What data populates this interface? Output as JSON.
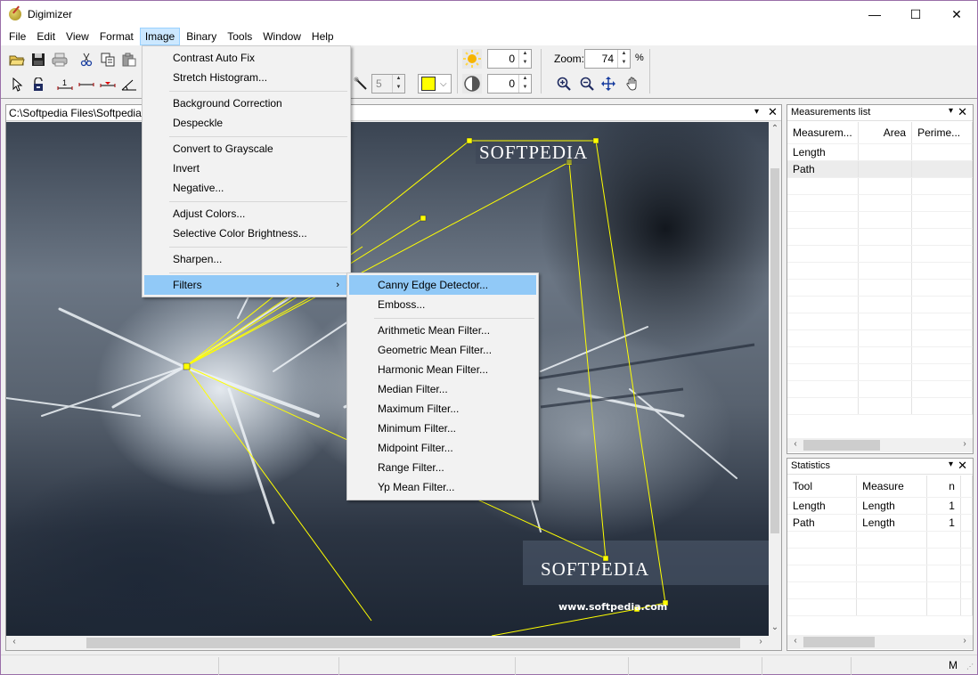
{
  "app": {
    "title": "Digimizer",
    "window_controls": {
      "minimize": "—",
      "maximize": "☐",
      "close": "✕"
    }
  },
  "menubar": {
    "items": [
      {
        "label": "File"
      },
      {
        "label": "Edit"
      },
      {
        "label": "View"
      },
      {
        "label": "Format"
      },
      {
        "label": "Image",
        "active": true
      },
      {
        "label": "Binary"
      },
      {
        "label": "Tools"
      },
      {
        "label": "Window"
      },
      {
        "label": "Help"
      }
    ]
  },
  "toolbar": {
    "row1_icons": [
      "open-folder-icon",
      "save-icon",
      "print-icon",
      "cut-icon",
      "copy-icon",
      "paste-icon"
    ],
    "row2_icons": [
      "pointer-icon",
      "unlock-icon",
      "length-marker-icon",
      "line-icon",
      "path-marker-icon",
      "angle-icon"
    ],
    "magic_wand_tolerance": "5",
    "color_swatch": "#ffff00",
    "brightness_value": "0",
    "contrast_value": "0",
    "zoom_label": "Zoom:",
    "zoom_value": "74",
    "zoom_unit": "%"
  },
  "document": {
    "path": "C:\\Softpedia Files\\Softpedia W",
    "watermark_top": "SOFTPEDIA",
    "watermark_bottom": "SOFTPEDIA",
    "watermark_url": "www.softpedia.com",
    "overlay_color": "#ffff00"
  },
  "image_menu": {
    "items": [
      {
        "label": "Contrast Auto Fix"
      },
      {
        "label": "Stretch Histogram..."
      },
      {
        "separator": true
      },
      {
        "label": "Background Correction"
      },
      {
        "label": "Despeckle"
      },
      {
        "separator": true
      },
      {
        "label": "Convert to Grayscale"
      },
      {
        "label": "Invert"
      },
      {
        "label": "Negative..."
      },
      {
        "separator": true
      },
      {
        "label": "Adjust Colors..."
      },
      {
        "label": "Selective Color Brightness..."
      },
      {
        "separator": true
      },
      {
        "label": "Sharpen..."
      },
      {
        "separator": true
      },
      {
        "label": "Filters",
        "submenu": true,
        "highlighted": true
      }
    ]
  },
  "filters_submenu": {
    "items": [
      {
        "label": "Canny Edge Detector...",
        "highlighted": true
      },
      {
        "label": "Emboss..."
      },
      {
        "separator": true
      },
      {
        "label": "Arithmetic Mean Filter..."
      },
      {
        "label": "Geometric Mean Filter..."
      },
      {
        "label": "Harmonic Mean Filter..."
      },
      {
        "label": "Median Filter..."
      },
      {
        "label": "Maximum Filter..."
      },
      {
        "label": "Minimum Filter..."
      },
      {
        "label": "Midpoint Filter..."
      },
      {
        "label": "Range Filter..."
      },
      {
        "label": "Yp Mean Filter..."
      }
    ]
  },
  "measurements_list": {
    "title": "Measurements list",
    "columns": [
      "Measurem...",
      "Area",
      "Perime..."
    ],
    "rows": [
      [
        "Length",
        "",
        ""
      ],
      [
        "Path",
        "",
        ""
      ]
    ]
  },
  "statistics": {
    "title": "Statistics",
    "columns": [
      "Tool",
      "Measure",
      "n"
    ],
    "rows": [
      [
        "Length",
        "Length",
        "1"
      ],
      [
        "Path",
        "Length",
        "1"
      ]
    ]
  },
  "statusbar": {
    "mode": "M"
  }
}
